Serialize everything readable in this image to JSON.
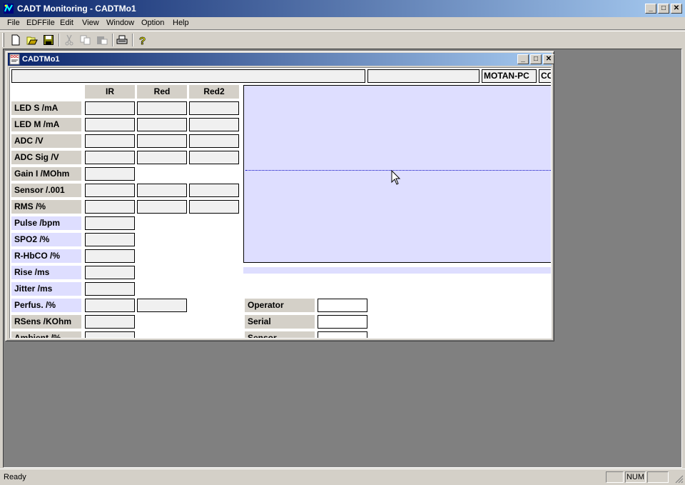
{
  "app": {
    "title": "CADT Monitoring - CADTMo1",
    "menu": [
      "File",
      "EDFFile",
      "Edit",
      "View",
      "Window",
      "Option",
      "Help"
    ],
    "toolbar": [
      "new-icon",
      "open-icon",
      "save-icon",
      "cut-icon",
      "copy-icon",
      "paste-icon",
      "print-icon",
      "help-icon"
    ]
  },
  "child": {
    "title": "CADTMo1",
    "topbar": {
      "field1": "",
      "field2": "",
      "computer": "MOTAN-PC",
      "port": "CC"
    },
    "columns": [
      "IR",
      "Red",
      "Red2"
    ],
    "rows": [
      {
        "label": "LED S /mA",
        "cells": 3,
        "style": "gray"
      },
      {
        "label": "LED M /mA",
        "cells": 3,
        "style": "gray"
      },
      {
        "label": "ADC /V",
        "cells": 3,
        "style": "gray"
      },
      {
        "label": "ADC Sig /V",
        "cells": 3,
        "style": "gray"
      },
      {
        "label": "Gain I /MOhm",
        "cells": 1,
        "style": "gray"
      },
      {
        "label": "Sensor /.001",
        "cells": 3,
        "style": "gray"
      },
      {
        "label": "RMS /%",
        "cells": 3,
        "style": "gray"
      },
      {
        "label": "Pulse /bpm",
        "cells": 1,
        "style": "blue"
      },
      {
        "label": "SPO2 /%",
        "cells": 1,
        "style": "blue"
      },
      {
        "label": "R-HbCO /%",
        "cells": 1,
        "style": "blue"
      },
      {
        "label": "Rise /ms",
        "cells": 1,
        "style": "blue"
      },
      {
        "label": "Jitter /ms",
        "cells": 1,
        "style": "blue"
      },
      {
        "label": "Perfus. /%",
        "cells": 2,
        "style": "blue"
      },
      {
        "label": "RSens /KOhm",
        "cells": 1,
        "style": "gray"
      },
      {
        "label": "Ambient /%",
        "cells": 1,
        "style": "gray"
      }
    ],
    "info": [
      {
        "label": "Operator",
        "value": ""
      },
      {
        "label": "Serial",
        "value": ""
      },
      {
        "label": "Sensor",
        "value": ""
      }
    ],
    "colors": {
      "plot_bg": "#dedeff",
      "label_gray": "#d4d0c8",
      "label_blue": "#dedeff",
      "trace": "#0000c0"
    }
  },
  "status": {
    "text": "Ready",
    "panes": [
      "",
      "NUM",
      ""
    ]
  }
}
